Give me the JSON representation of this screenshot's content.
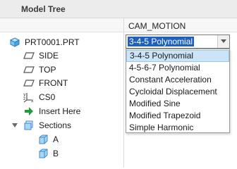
{
  "panel": {
    "title": "Model Tree"
  },
  "column": {
    "header": "CAM_MOTION"
  },
  "tree": {
    "root": "PRT0001.PRT",
    "items": [
      "SIDE",
      "TOP",
      "FRONT",
      "CS0",
      "Insert Here",
      "Sections",
      "A",
      "B"
    ]
  },
  "select": {
    "value": "3-4-5 Polynomial",
    "options": [
      "3-4-5 Polynomial",
      "4-5-6-7 Polynomial",
      "Constant Acceleration",
      "Cycloidal Displacement",
      "Modified Sine",
      "Modified Trapezoid",
      "Simple Harmonic"
    ]
  },
  "colors": {
    "selection_blue": "#1f5fbf",
    "highlight": "#cce4f7",
    "icon_blue": "#5aa9e6",
    "insert_green": "#1e9e3a"
  }
}
